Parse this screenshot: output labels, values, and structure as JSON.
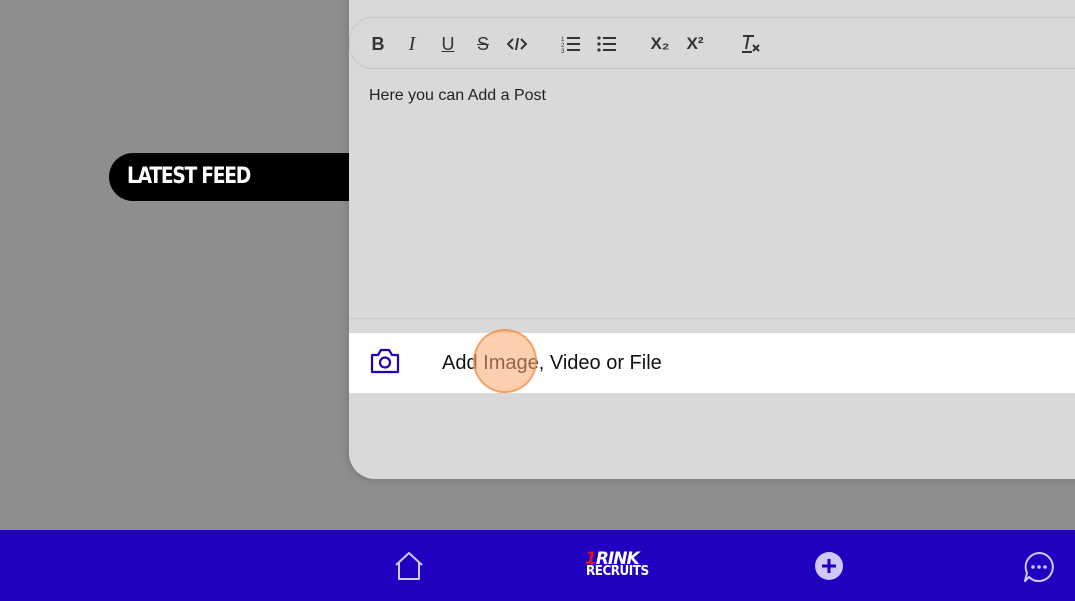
{
  "feed": {
    "title": "LATEST FEED"
  },
  "editor": {
    "toolbar": {
      "bold": "B",
      "italic": "I",
      "underline": "U",
      "strike": "S",
      "code": "code-icon",
      "ordered_list": "ordered-list-icon",
      "bullet_list": "bullet-list-icon",
      "subscript": "X₂",
      "superscript": "X²",
      "clear_format": "clear-format-icon"
    },
    "body_text": "Here you can Add a Post"
  },
  "attach": {
    "label": "Add Image, Video or File",
    "icon": "camera-icon"
  },
  "bottom_nav": {
    "home_icon": "home-icon",
    "logo_top_number": "1",
    "logo_top": "RINK",
    "logo_bottom": "RECRUITS",
    "add_icon": "plus-circle-icon",
    "chat_icon": "chat-icon"
  },
  "colors": {
    "nav_bg": "#2200bf",
    "accent": "#2200bf",
    "overlay": "#8e8e8e"
  }
}
